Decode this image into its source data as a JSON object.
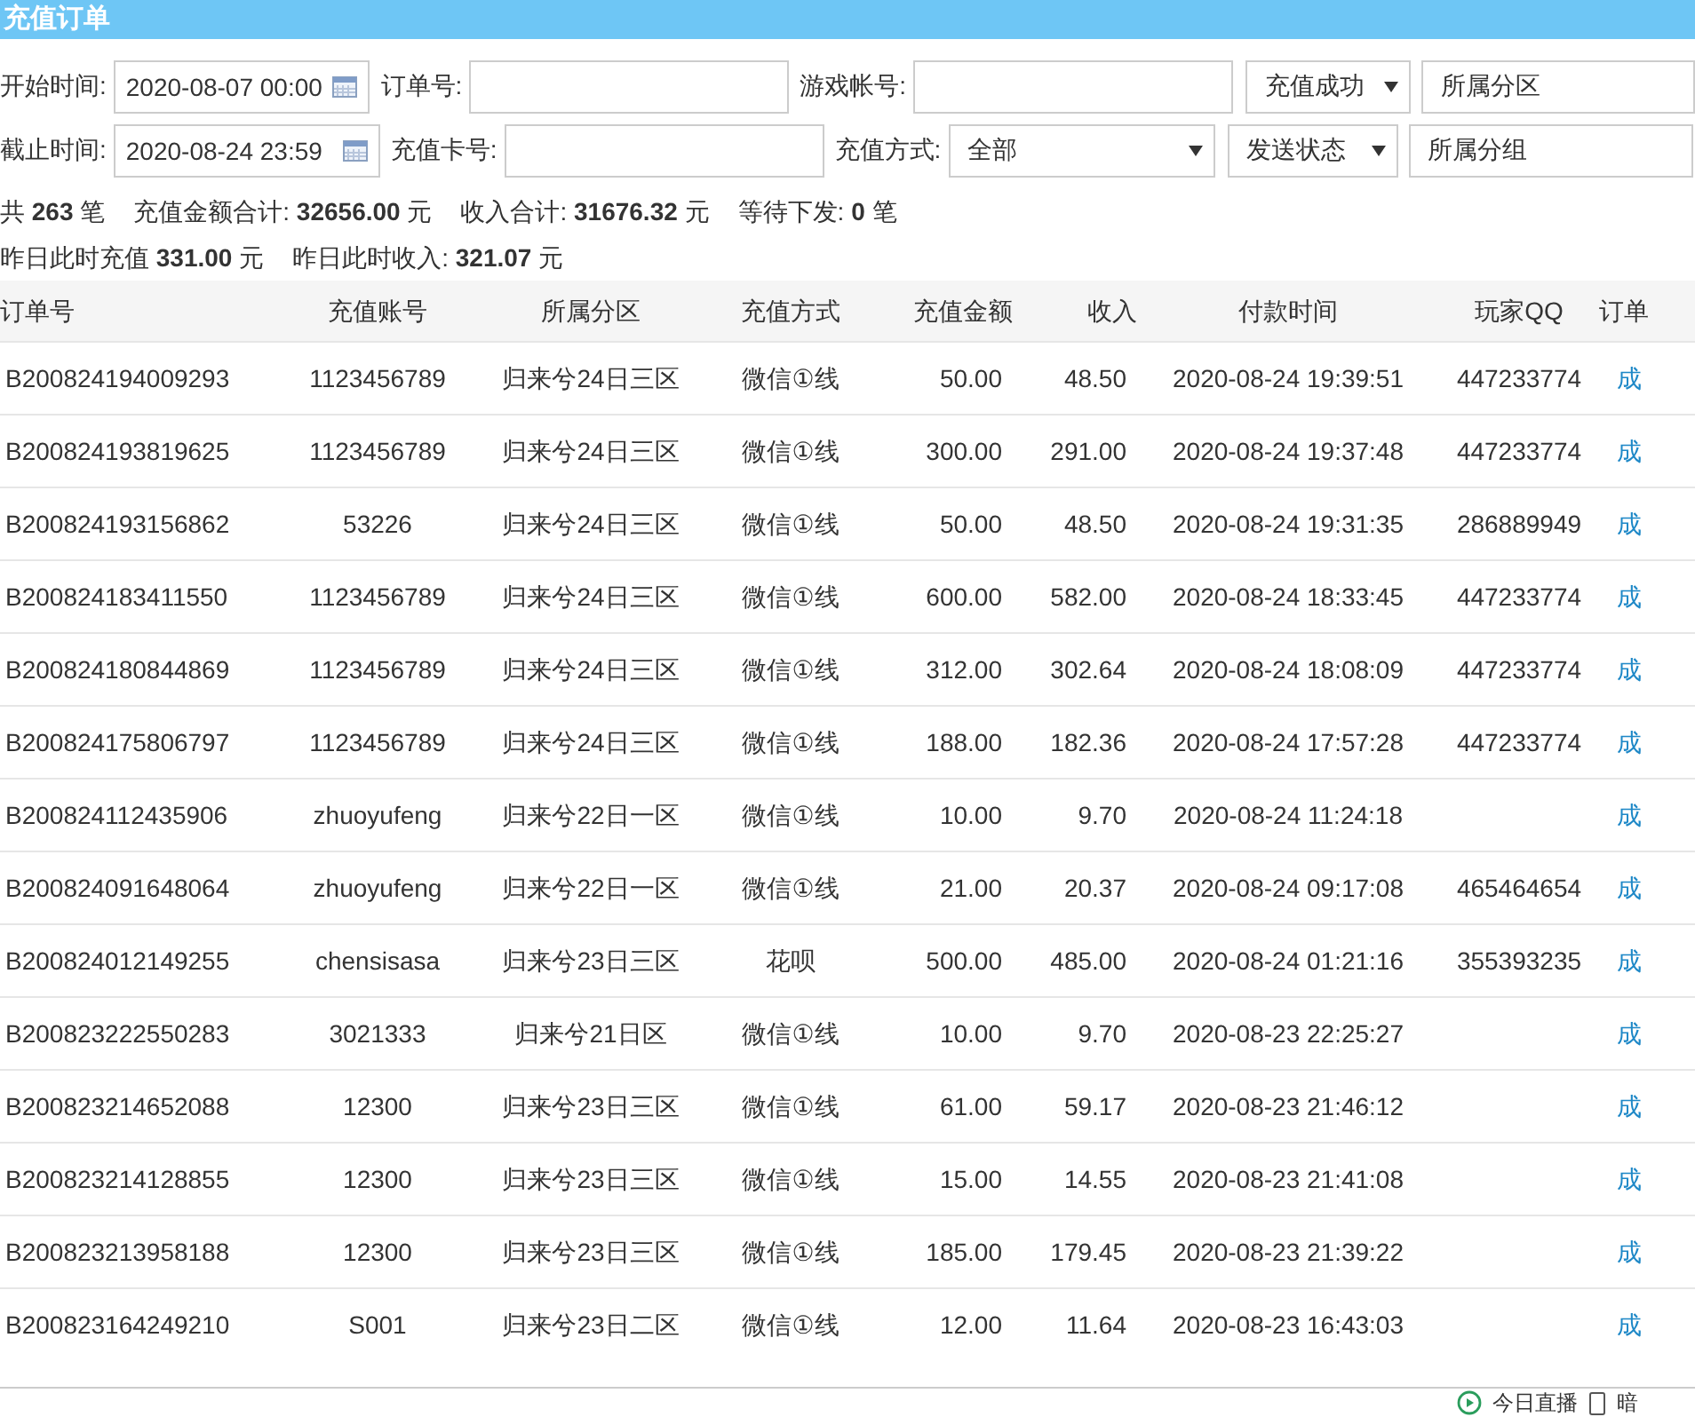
{
  "title": "充值订单",
  "filters": [
    [
      {
        "kind": "label",
        "text": "开始时间:"
      },
      {
        "kind": "date",
        "value": "2020-08-07 00:00"
      },
      {
        "kind": "label",
        "text": "订单号:"
      },
      {
        "kind": "text"
      },
      {
        "kind": "label",
        "text": "游戏帐号:"
      },
      {
        "kind": "text"
      },
      {
        "kind": "select",
        "value": "充值成功"
      },
      {
        "kind": "input",
        "value": "所属分区"
      }
    ],
    [
      {
        "kind": "label",
        "text": "截止时间:"
      },
      {
        "kind": "date",
        "value": "2020-08-24 23:59"
      },
      {
        "kind": "label",
        "text": "充值卡号:"
      },
      {
        "kind": "text"
      },
      {
        "kind": "label",
        "text": "充值方式:"
      },
      {
        "kind": "select-wide",
        "value": "全部"
      },
      {
        "kind": "select",
        "value": "发送状态"
      },
      {
        "kind": "input",
        "value": "所属分组"
      }
    ]
  ],
  "stats": [
    [
      "共 **263** 笔",
      "充值金额合计: **32656.00** 元",
      "收入合计: **31676.32** 元",
      "等待下发: **0** 笔"
    ],
    [
      "昨日此时充值 **331.00** 元",
      "昨日此时收入: **321.07** 元"
    ]
  ],
  "table": {
    "columns": [
      "订单号",
      "充值账号",
      "所属分区",
      "充值方式",
      "充值金额",
      "收入",
      "付款时间",
      "玩家QQ",
      "订单"
    ],
    "rows": [
      [
        "B200824194009293",
        "1123456789",
        "归来兮24日三区",
        "微信①线",
        "50.00",
        "48.50",
        "2020-08-24 19:39:51",
        "447233774",
        "成"
      ],
      [
        "B200824193819625",
        "1123456789",
        "归来兮24日三区",
        "微信①线",
        "300.00",
        "291.00",
        "2020-08-24 19:37:48",
        "447233774",
        "成"
      ],
      [
        "B200824193156862",
        "53226",
        "归来兮24日三区",
        "微信①线",
        "50.00",
        "48.50",
        "2020-08-24 19:31:35",
        "286889949",
        "成"
      ],
      [
        "B200824183411550",
        "1123456789",
        "归来兮24日三区",
        "微信①线",
        "600.00",
        "582.00",
        "2020-08-24 18:33:45",
        "447233774",
        "成"
      ],
      [
        "B200824180844869",
        "1123456789",
        "归来兮24日三区",
        "微信①线",
        "312.00",
        "302.64",
        "2020-08-24 18:08:09",
        "447233774",
        "成"
      ],
      [
        "B200824175806797",
        "1123456789",
        "归来兮24日三区",
        "微信①线",
        "188.00",
        "182.36",
        "2020-08-24 17:57:28",
        "447233774",
        "成"
      ],
      [
        "B200824112435906",
        "zhuoyufeng",
        "归来兮22日一区",
        "微信①线",
        "10.00",
        "9.70",
        "2020-08-24 11:24:18",
        "",
        "成"
      ],
      [
        "B200824091648064",
        "zhuoyufeng",
        "归来兮22日一区",
        "微信①线",
        "21.00",
        "20.37",
        "2020-08-24 09:17:08",
        "465464654",
        "成"
      ],
      [
        "B200824012149255",
        "chensisasa",
        "归来兮23日三区",
        "花呗",
        "500.00",
        "485.00",
        "2020-08-24 01:21:16",
        "355393235",
        "成"
      ],
      [
        "B200823222550283",
        "3021333",
        "归来兮21日区",
        "微信①线",
        "10.00",
        "9.70",
        "2020-08-23 22:25:27",
        "",
        "成"
      ],
      [
        "B200823214652088",
        "12300",
        "归来兮23日三区",
        "微信①线",
        "61.00",
        "59.17",
        "2020-08-23 21:46:12",
        "",
        "成"
      ],
      [
        "B200823214128855",
        "12300",
        "归来兮23日三区",
        "微信①线",
        "15.00",
        "14.55",
        "2020-08-23 21:41:08",
        "",
        "成"
      ],
      [
        "B200823213958188",
        "12300",
        "归来兮23日三区",
        "微信①线",
        "185.00",
        "179.45",
        "2020-08-23 21:39:22",
        "",
        "成"
      ],
      [
        "B200823164249210",
        "S001",
        "归来兮23日二区",
        "微信①线",
        "12.00",
        "11.64",
        "2020-08-23 16:43:03",
        "",
        "成"
      ]
    ]
  },
  "bottom_bar": [
    "今日直播",
    "暗"
  ]
}
